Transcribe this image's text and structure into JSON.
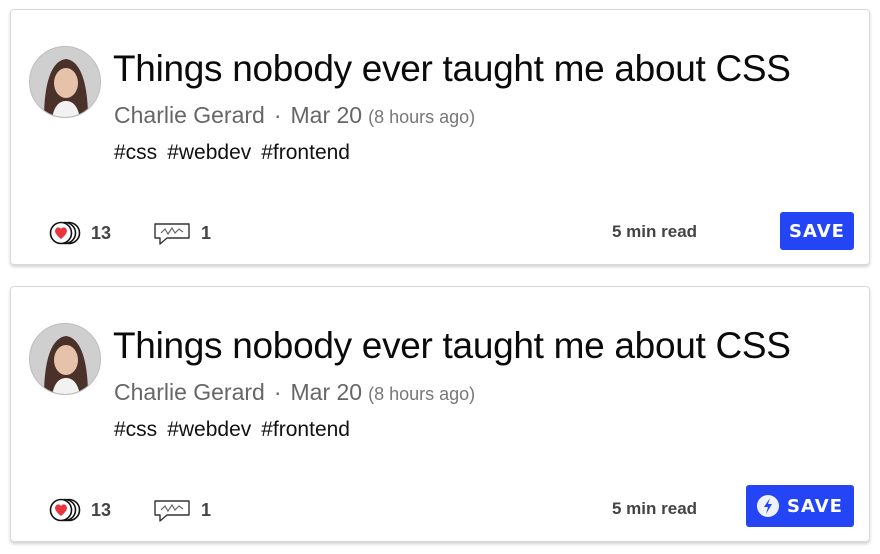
{
  "cards": [
    {
      "title": "Things nobody ever taught me about CSS",
      "author": "Charlie Gerard",
      "separator": "·",
      "date": "Mar 20",
      "relative_time": "(8 hours ago)",
      "tags": [
        "#css",
        "#webdev",
        "#frontend"
      ],
      "reactions_count": "13",
      "comments_count": "1",
      "read_time": "5 min read",
      "save_label": "SAVE"
    },
    {
      "title": "Things nobody ever taught me about CSS",
      "author": "Charlie Gerard",
      "separator": "·",
      "date": "Mar 20",
      "relative_time": "(8 hours ago)",
      "tags": [
        "#css",
        "#webdev",
        "#frontend"
      ],
      "reactions_count": "13",
      "comments_count": "1",
      "read_time": "5 min read",
      "save_label": "SAVE",
      "save_icon": "bolt-icon"
    }
  ],
  "colors": {
    "save_button": "#2445f5",
    "heart": "#e8343f",
    "meta_text": "#666666"
  },
  "icons": [
    "heart-icon",
    "comment-icon",
    "bolt-icon"
  ]
}
